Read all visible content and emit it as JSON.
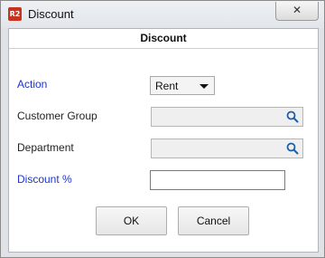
{
  "window": {
    "icon_text": "R2",
    "title": "Discount",
    "close_glyph": "✕"
  },
  "dialog": {
    "header": "Discount"
  },
  "form": {
    "action": {
      "label": "Action",
      "value": "Rent"
    },
    "customer_group": {
      "label": "Customer Group",
      "value": "",
      "icon": "search-icon"
    },
    "department": {
      "label": "Department",
      "value": "",
      "icon": "search-icon"
    },
    "discount_percent": {
      "label": "Discount %",
      "value": ""
    }
  },
  "buttons": {
    "ok": "OK",
    "cancel": "Cancel"
  },
  "colors": {
    "required_label": "#1f33c9",
    "search_icon": "#1a5fa8"
  }
}
